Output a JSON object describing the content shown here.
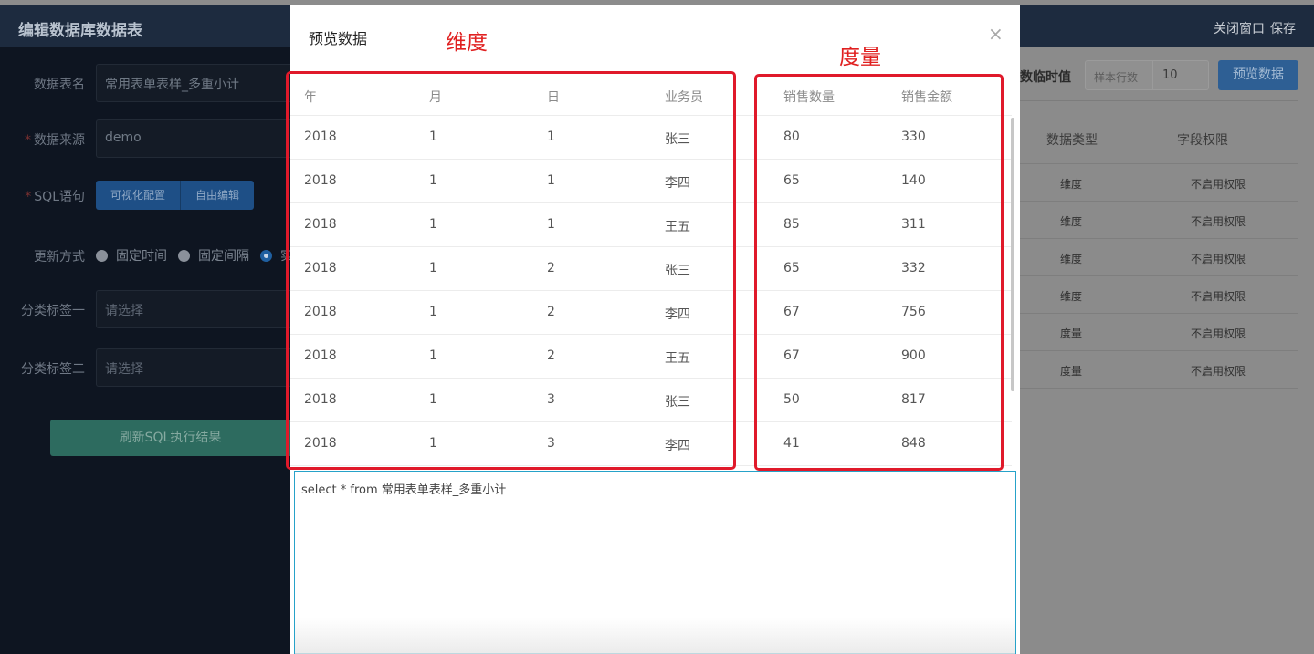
{
  "app": {
    "title": "编辑数据库数据表",
    "close_window": "关闭窗口",
    "save": "保存"
  },
  "form": {
    "table_name_label": "数据表名",
    "table_name_value": "常用表单表样_多重小计",
    "source_label": "数据来源",
    "source_value": "demo",
    "sql_label": "SQL语句",
    "visual_config": "可视化配置",
    "free_edit": "自由编辑",
    "update_label": "更新方式",
    "opt_fixed_time": "固定时间",
    "opt_fixed_interval": "固定间隔",
    "opt_third_partial": "实",
    "tag1_label": "分类标签一",
    "tag1_placeholder": "请选择",
    "tag2_label": "分类标签二",
    "tag2_placeholder": "请选择",
    "refresh_button": "刷新SQL执行结果",
    "required_mark": "*"
  },
  "right_panel": {
    "temp_value_label": "数临时值",
    "sample_rows_placeholder": "样本行数",
    "sample_rows_value": "10",
    "preview_button": "预览数据",
    "col_type": "数据类型",
    "col_permission": "字段权限",
    "rows": [
      {
        "type": "维度",
        "permission": "不启用权限"
      },
      {
        "type": "维度",
        "permission": "不启用权限"
      },
      {
        "type": "维度",
        "permission": "不启用权限"
      },
      {
        "type": "维度",
        "permission": "不启用权限"
      },
      {
        "type": "度量",
        "permission": "不启用权限"
      },
      {
        "type": "度量",
        "permission": "不启用权限"
      }
    ]
  },
  "modal": {
    "title": "预览数据",
    "close_icon": "×",
    "annotation_dimension": "维度",
    "annotation_measure": "度量",
    "headers": [
      "年",
      "月",
      "日",
      "业务员",
      "销售数量",
      "销售金额"
    ],
    "rows": [
      [
        "2018",
        "1",
        "1",
        "张三",
        "80",
        "330"
      ],
      [
        "2018",
        "1",
        "1",
        "李四",
        "65",
        "140"
      ],
      [
        "2018",
        "1",
        "1",
        "王五",
        "85",
        "311"
      ],
      [
        "2018",
        "1",
        "2",
        "张三",
        "65",
        "332"
      ],
      [
        "2018",
        "1",
        "2",
        "李四",
        "67",
        "756"
      ],
      [
        "2018",
        "1",
        "2",
        "王五",
        "67",
        "900"
      ],
      [
        "2018",
        "1",
        "3",
        "张三",
        "50",
        "817"
      ],
      [
        "2018",
        "1",
        "3",
        "李四",
        "41",
        "848"
      ]
    ],
    "sql": "select * from 常用表单表样_多重小计"
  }
}
